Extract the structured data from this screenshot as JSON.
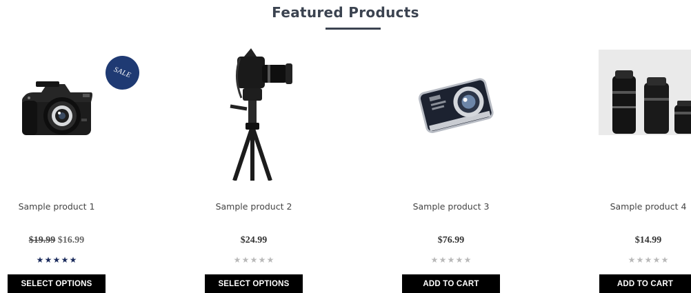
{
  "section": {
    "title": "Featured Products"
  },
  "products": [
    {
      "name": "Sample product 1",
      "price_old": "$19.99",
      "price_new": "$16.99",
      "rating": 5,
      "badge": "SALE",
      "button": "SELECT OPTIONS",
      "image_icon": "dslr-camera-icon"
    },
    {
      "name": "Sample product 2",
      "price": "$24.99",
      "rating": 0,
      "button": "SELECT OPTIONS",
      "image_icon": "camera-on-tripod-icon"
    },
    {
      "name": "Sample product 3",
      "price": "$76.99",
      "rating": 0,
      "button": "ADD TO CART",
      "image_icon": "compact-camera-icon"
    },
    {
      "name": "Sample product 4",
      "price": "$14.99",
      "rating": 0,
      "button": "ADD TO CART",
      "image_icon": "camera-lenses-icon"
    }
  ],
  "colors": {
    "title": "#3b4350",
    "badge": "#1f3a73",
    "star_filled": "#1a2b5c",
    "star_empty": "#b9b9b9",
    "button_bg": "#000000"
  }
}
